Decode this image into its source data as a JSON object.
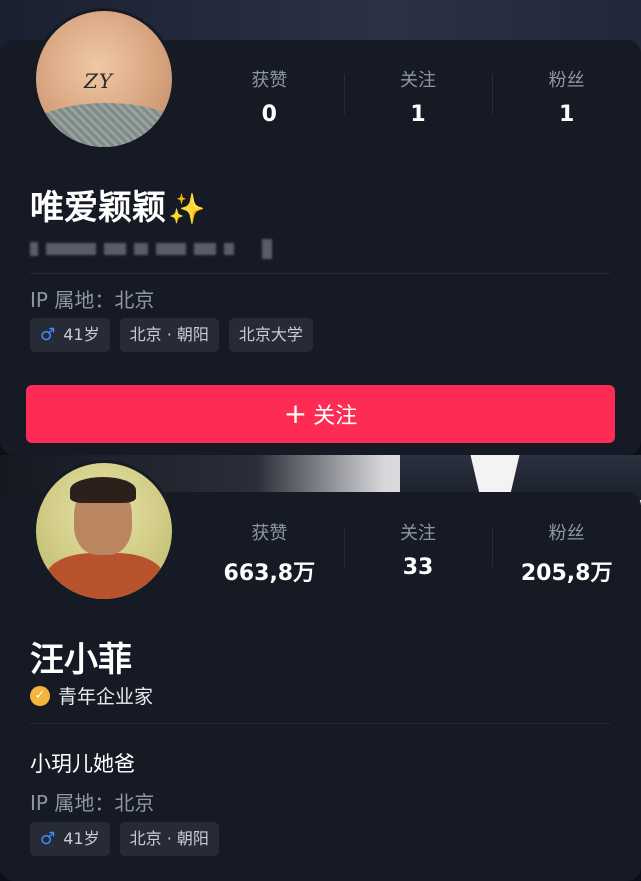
{
  "profile1": {
    "name": "唯爱颖颖",
    "name_emoji": "✨",
    "avatar_text": "ZY",
    "stats": [
      {
        "label": "获赞",
        "value": "0"
      },
      {
        "label": "关注",
        "value": "1"
      },
      {
        "label": "粉丝",
        "value": "1"
      }
    ],
    "ip_location": "IP 属地：北京",
    "tags": {
      "age": "41岁",
      "location": "北京 · 朝阳",
      "school": "北京大学"
    },
    "follow_button": "关注"
  },
  "profile2": {
    "name": "汪小菲",
    "verified_label": "青年企业家",
    "stats": [
      {
        "label": "获赞",
        "value": "663,8万"
      },
      {
        "label": "关注",
        "value": "33"
      },
      {
        "label": "粉丝",
        "value": "205,8万"
      }
    ],
    "bio": "小玥儿她爸",
    "ip_location": "IP 属地：北京",
    "tags": {
      "age": "41岁",
      "location": "北京 · 朝阳"
    }
  },
  "icons": {
    "male": "male-symbol-icon",
    "verified": "verified-check-icon",
    "plus": "plus-icon",
    "sparkles": "sparkles-icon"
  },
  "colors": {
    "follow_button": "#fe2c55",
    "male_icon": "#3d8dff",
    "verified_badge": "#f5b43a",
    "card_bg": "#161a25"
  }
}
